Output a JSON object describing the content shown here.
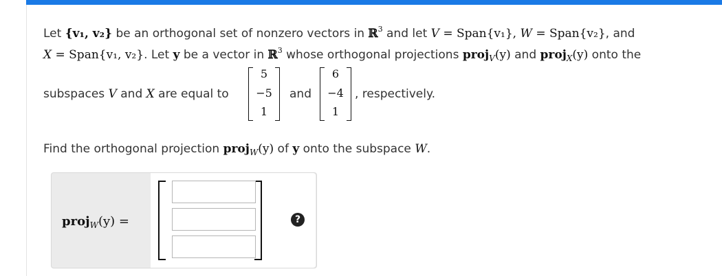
{
  "problem": {
    "line1": {
      "let": "Let ",
      "set": "{v₁, v₂}",
      "t1": " be an orthogonal set of nonzero vectors in ",
      "R": "ℝ",
      "exp": "3",
      "t2": " and let ",
      "V": "V",
      "eq1": " = Span{v₁}, ",
      "W": "W",
      "eq2": " = Span{v₂}",
      "t3": ", and"
    },
    "line2": {
      "X": "X",
      "eq": " = Span{v₁, v₂}",
      "t1": ". Let ",
      "y": "y",
      "t2": " be a vector in ",
      "R": "ℝ",
      "exp": "3",
      "t3": " whose orthogonal projections ",
      "proj": "proj",
      "V": "V",
      "arg": "(y)",
      "and": " and ",
      "proj2": "proj",
      "arg2": "(y)",
      "t4": " onto the"
    },
    "line3": {
      "t1": "subspaces ",
      "V": "V",
      "and": " and ",
      "X": "X",
      "t2": " are equal to",
      "and2": "and",
      "t3": ", respectively."
    },
    "vector1": [
      "5",
      "−5",
      "1"
    ],
    "vector2": [
      "6",
      "−4",
      "1"
    ],
    "find": {
      "t1": "Find the orthogonal projection ",
      "proj": "proj",
      "W": "W",
      "arg": "(y)",
      "t2": " of ",
      "y": "y",
      "t3": " onto the subspace ",
      "W2": "W",
      "dot": "."
    }
  },
  "answer": {
    "proj": "proj",
    "W": "W",
    "arg": "(y) =",
    "help_icon": "question-circle-icon"
  }
}
